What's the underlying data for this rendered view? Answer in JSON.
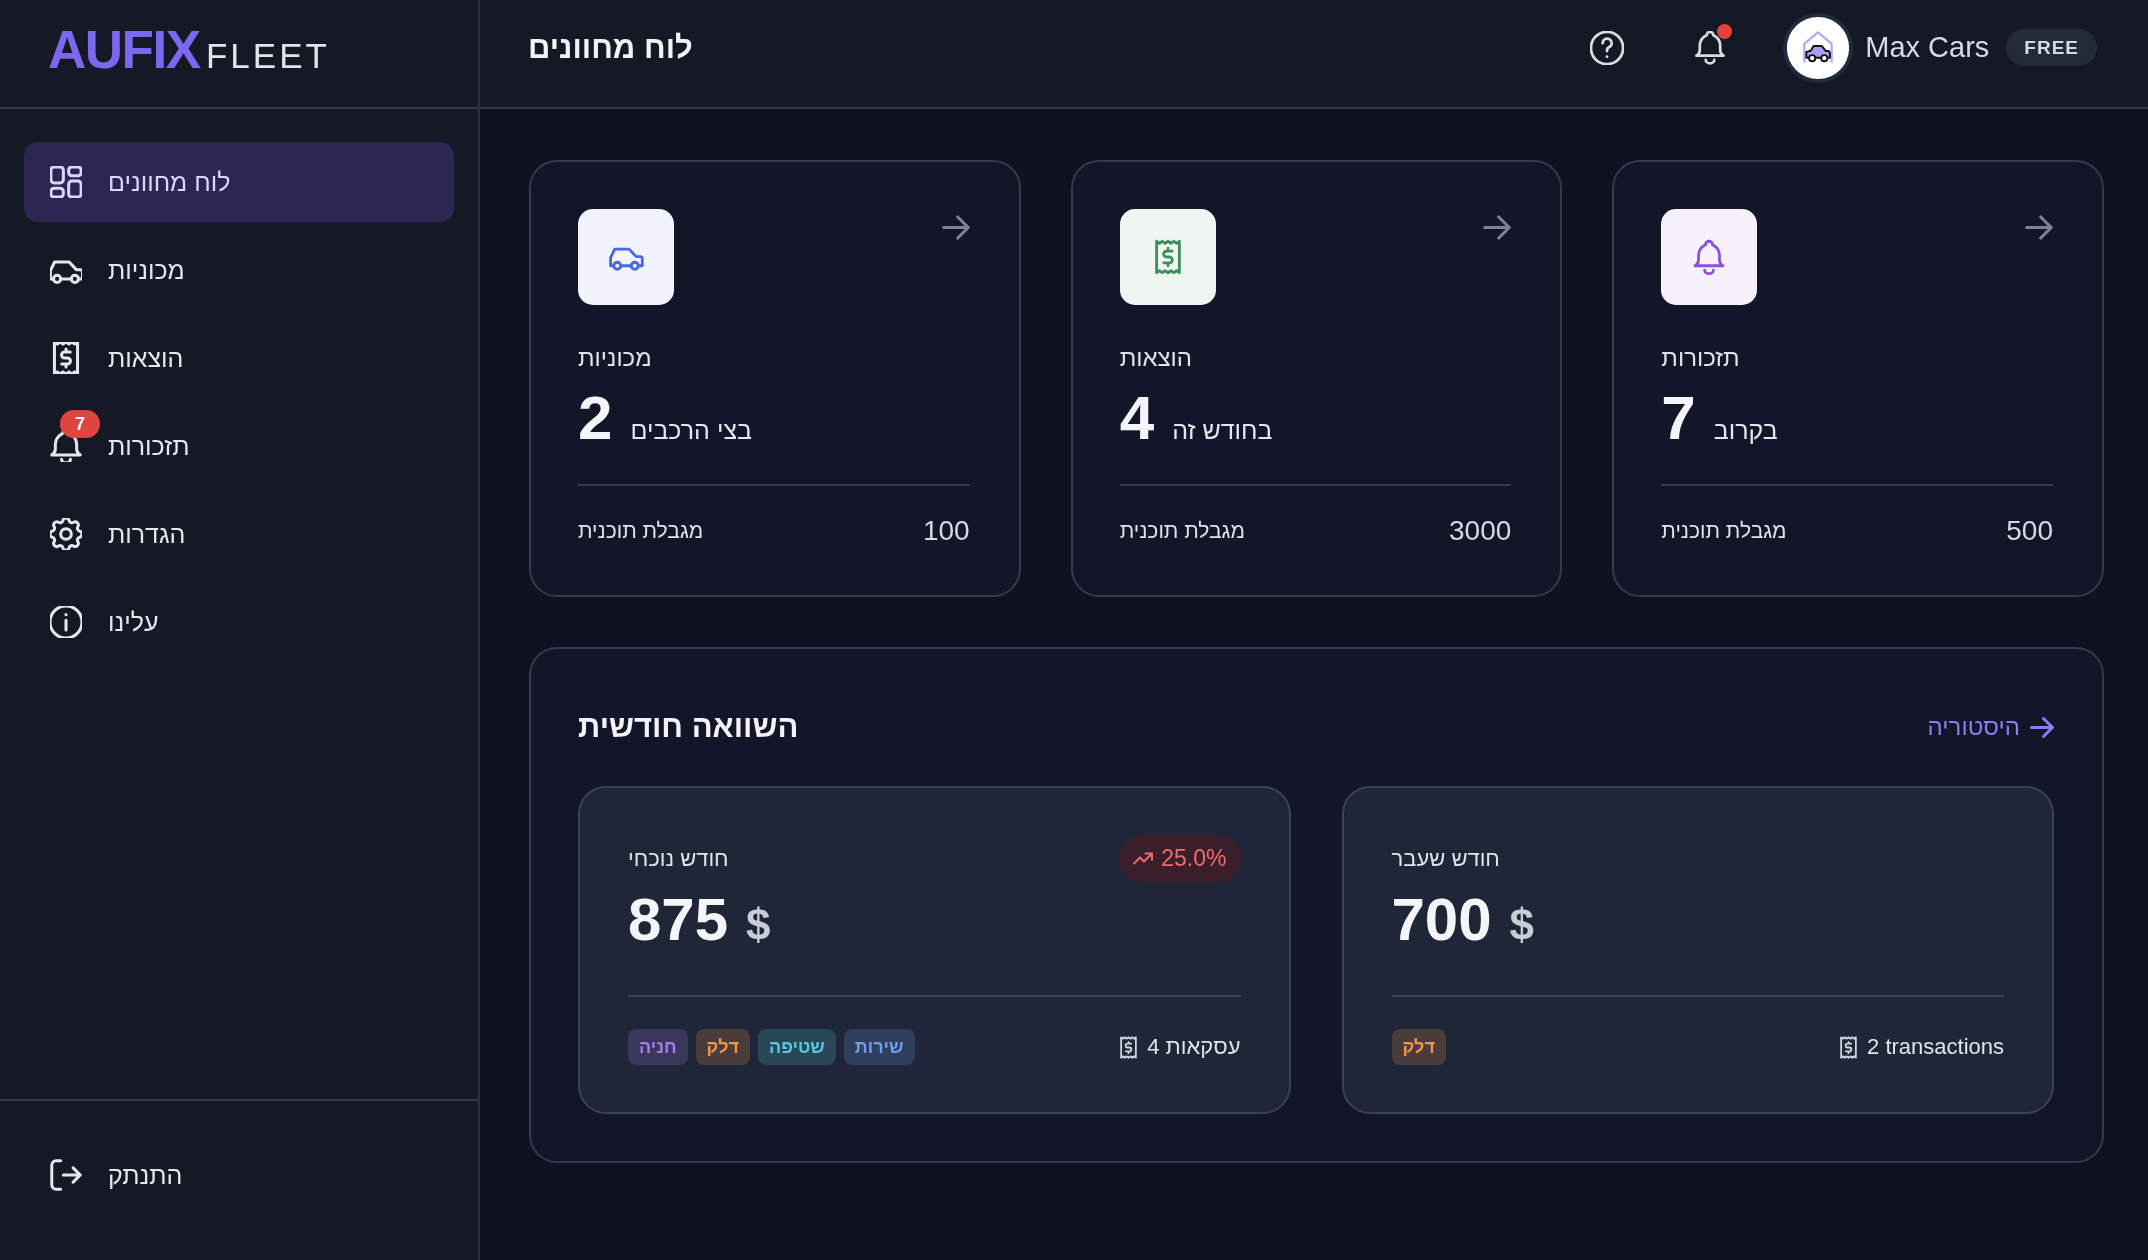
{
  "brand": {
    "name": "AUFIX",
    "product": "FLEET"
  },
  "sidebar": {
    "items": [
      {
        "kind": "dashboard",
        "label": "לוח מחוונים",
        "selected": true
      },
      {
        "kind": "cars",
        "label": "מכוניות",
        "selected": false
      },
      {
        "kind": "expenses",
        "label": "הוצאות",
        "selected": false
      },
      {
        "kind": "reminders",
        "label": "תזכורות",
        "selected": false,
        "badge": "7"
      },
      {
        "kind": "settings",
        "label": "הגדרות",
        "selected": false
      },
      {
        "kind": "about",
        "label": "עלינו",
        "selected": false
      }
    ],
    "logout": {
      "label": "התנתק"
    }
  },
  "header": {
    "title": "לוח מחוונים",
    "notifications": {
      "unread": true
    },
    "user": {
      "name": "Max Cars",
      "plan": "FREE"
    }
  },
  "stat_cards": [
    {
      "kind": "reminders",
      "color": "#8b4fe0",
      "label": "תזכורות",
      "value": "7",
      "caption": "בקרוב",
      "limit_label": "מגבלת תוכנית",
      "limit": "500"
    },
    {
      "kind": "expenses",
      "color": "#3c8f5a",
      "label": "הוצאות",
      "value": "4",
      "caption": "בחודש זה",
      "limit_label": "מגבלת תוכנית",
      "limit": "3000"
    },
    {
      "kind": "cars",
      "color": "#4a67e0",
      "label": "מכוניות",
      "value": "2",
      "caption": "בצי הרכבים",
      "limit_label": "מגבלת תוכנית",
      "limit": "100"
    }
  ],
  "monthly_comparison": {
    "title": "השוואה חודשית",
    "history_link": "היסטוריה",
    "periods": [
      {
        "label": "חודש שעבר",
        "amount": "700",
        "currency": "$",
        "tags": [
          {
            "label": "דלק",
            "color": "#f0954a"
          }
        ],
        "transactions": "2 transactions"
      },
      {
        "label": "חודש נוכחי",
        "amount": "875",
        "currency": "$",
        "change": {
          "increase": true,
          "value": "25.0%"
        },
        "tags": [
          {
            "label": "שירות",
            "color": "#6f9cf2"
          },
          {
            "label": "שטיפה",
            "color": "#56c8e0"
          },
          {
            "label": "דלק",
            "color": "#f0954a"
          },
          {
            "label": "חניה",
            "color": "#a77bf3"
          }
        ],
        "transactions": "4 עסקאות"
      }
    ]
  }
}
